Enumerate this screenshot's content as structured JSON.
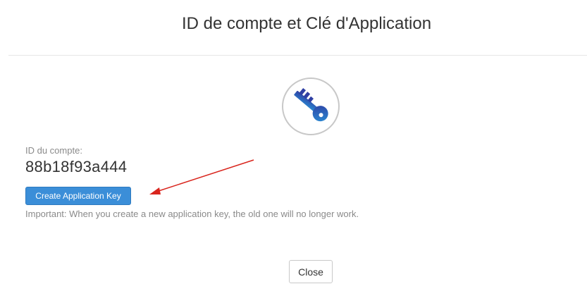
{
  "modal": {
    "title": "ID de compte et Clé d'Application"
  },
  "icon": {
    "name": "key-icon",
    "color_dark": "#2e3fa3",
    "color_light": "#2a8fd6"
  },
  "account": {
    "label": "ID du compte:",
    "value": "88b18f93a444"
  },
  "actions": {
    "create_label": "Create Application Key",
    "close_label": "Close"
  },
  "note": {
    "text": "Important: When you create a new application key, the old one will no longer work."
  },
  "annotation": {
    "arrow_color": "#d9251d"
  },
  "colors": {
    "primary_button": "#3b8ed8"
  }
}
